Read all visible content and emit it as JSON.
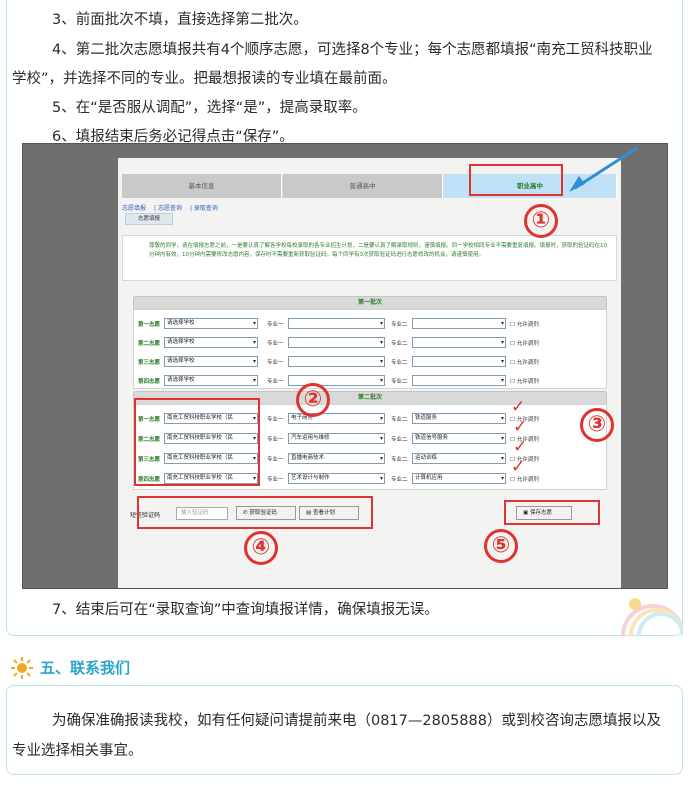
{
  "instructions": {
    "step3": "3、前面批次不填，直接选择第二批次。",
    "step4": "4、第二批次志愿填报共有4个顺序志愿，可选择8个专业；每个志愿都填报“南充工贸科技职业学校”，并选择不同的专业。把最想报读的专业填在最前面。",
    "step5": "5、在“是否服从调配”，选择“是”，提高录取率。",
    "step6": "6、填报结束后务必记得点击“保存”。",
    "step7": "7、结束后可在“录取查询”中查询填报详情，确保填报无误。"
  },
  "screenshot": {
    "tabs": [
      "基本信息",
      "普通高中",
      "职业高中"
    ],
    "subtabs": [
      "志愿填报",
      "志愿查询",
      "录取查询"
    ],
    "panel_label": "志愿填报",
    "notice": "尊敬的同学，请在填报志愿之前，一是要认真了解各学校每校录取的各专业招生计划，二是要认真了解录取规则，谨慎填报。同一学校相同专业不需要重复填报。填报时，获取的验证码在10分钟内有效，10分钟内需要修改志愿内容，保存时不需要重新获取验证码。每个同学有3次获取验证码进行志愿修改的机会，请谨慎使用。",
    "batch1_title": "第一批次",
    "batch2_title": "第二批次",
    "batch1_rows": [
      {
        "label": "第一志愿",
        "school": "请选择学校",
        "major1": "",
        "major2": ""
      },
      {
        "label": "第二志愿",
        "school": "请选择学校",
        "major1": "",
        "major2": ""
      },
      {
        "label": "第三志愿",
        "school": "请选择学校",
        "major1": "",
        "major2": ""
      },
      {
        "label": "第四志愿",
        "school": "请选择学校",
        "major1": "",
        "major2": ""
      }
    ],
    "batch2_rows": [
      {
        "label": "第一志愿",
        "school": "南充工贸科技职业学校（民",
        "major1": "电子商务",
        "major2": "铁道服务"
      },
      {
        "label": "第二志愿",
        "school": "南充工贸科技职业学校（民",
        "major1": "汽车运用与维修",
        "major2": "铁道信号服务"
      },
      {
        "label": "第三志愿",
        "school": "南充工贸科技职业学校（民",
        "major1": "直播电商技术",
        "major2": "运动训练"
      },
      {
        "label": "第四志愿",
        "school": "南充工贸科技职业学校（民",
        "major1": "艺术设计与制作",
        "major2": "计算机应用"
      }
    ],
    "major1_label": "专业一",
    "major2_label": "专业二",
    "adjust_label": "允许调剂",
    "verify_label": "短信验证码",
    "verify_placeholder": "输入验证码",
    "get_code_btn": "获取验证码",
    "view_plan_btn": "查看计划",
    "save_btn": "保存志愿",
    "markers": [
      "①",
      "②",
      "③",
      "④",
      "⑤"
    ]
  },
  "section": {
    "title": "五、联系我们",
    "text": "为确保准确报读我校，如有任何疑问请提前来电（0817—2805888）或到校咨询志愿填报以及专业选择相关事宜。"
  },
  "colors": {
    "accent": "#2aa6c8",
    "marker_red": "#e0322e",
    "card_border": "#bde3ee"
  }
}
